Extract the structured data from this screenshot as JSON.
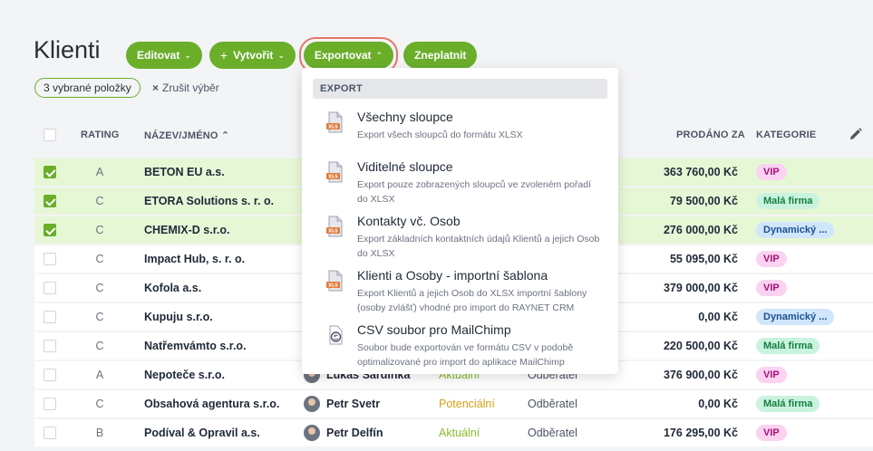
{
  "page": {
    "title": "Klienti"
  },
  "toolbar": {
    "edit_label": "Editovat",
    "create_label": "Vytvořit",
    "export_label": "Exportovat",
    "pay_label": "Zneplatnit"
  },
  "selection": {
    "count_label": "3 vybrané položky",
    "clear_label": "Zrušit výběr"
  },
  "table": {
    "headers": {
      "rating": "RATING",
      "name": "NÁZEV/JMÉNO",
      "sold": "PRODÁNO ZA",
      "category": "KATEGORIE"
    },
    "rows": [
      {
        "selected": true,
        "rating": "A",
        "name": "BETON EU a.s.",
        "person": "",
        "status": "",
        "role": "",
        "amount": "363 760,00 Kč",
        "category": "VIP",
        "cat_type": "vip"
      },
      {
        "selected": true,
        "rating": "C",
        "name": "ETORA Solutions s. r. o.",
        "person": "",
        "status": "",
        "role": "",
        "amount": "79 500,00 Kč",
        "category": "Malá firma",
        "cat_type": "mala"
      },
      {
        "selected": true,
        "rating": "C",
        "name": "CHEMIX-D s.r.o.",
        "person": "",
        "status": "",
        "role": "",
        "amount": "276 000,00 Kč",
        "category": "Dynamický ...",
        "cat_type": "dyn"
      },
      {
        "selected": false,
        "rating": "C",
        "name": "Impact Hub, s. r. o.",
        "person": "",
        "status": "",
        "role": "",
        "amount": "55 095,00 Kč",
        "category": "VIP",
        "cat_type": "vip"
      },
      {
        "selected": false,
        "rating": "C",
        "name": "Kofola a.s.",
        "person": "",
        "status": "",
        "role": "",
        "amount": "379 000,00 Kč",
        "category": "VIP",
        "cat_type": "vip"
      },
      {
        "selected": false,
        "rating": "C",
        "name": "Kupuju s.r.o.",
        "person": "",
        "status": "",
        "role": "",
        "amount": "0,00 Kč",
        "category": "Dynamický ...",
        "cat_type": "dyn"
      },
      {
        "selected": false,
        "rating": "C",
        "name": "Natřemvámto s.r.o.",
        "person": "",
        "status": "",
        "role": "",
        "amount": "220 500,00 Kč",
        "category": "Malá firma",
        "cat_type": "mala"
      },
      {
        "selected": false,
        "rating": "A",
        "name": "Nepoteče s.r.o.",
        "person": "Lukáš Sardinka",
        "status": "Aktuální",
        "role": "Odběratel",
        "amount": "376 900,00 Kč",
        "category": "VIP",
        "cat_type": "vip"
      },
      {
        "selected": false,
        "rating": "C",
        "name": "Obsahová agentura s.r.o.",
        "person": "Petr Svetr",
        "status": "Potenciální",
        "role": "Odběratel",
        "amount": "0,00 Kč",
        "category": "Malá firma",
        "cat_type": "mala"
      },
      {
        "selected": false,
        "rating": "B",
        "name": "Podíval & Opravil a.s.",
        "person": "Petr Delfín",
        "status": "Aktuální",
        "role": "Odběratel",
        "amount": "176 295,00 Kč",
        "category": "VIP",
        "cat_type": "vip"
      }
    ]
  },
  "export_menu": {
    "header": "EXPORT",
    "items": [
      {
        "title": "Všechny sloupce",
        "desc": "Export všech sloupců do formátu XLSX",
        "icon": "xls-file-icon"
      },
      {
        "title": "Viditelné sloupce",
        "desc": "Export pouze zobrazených sloupců ve zvoleném pořadí do XLSX",
        "icon": "xls-file-icon"
      },
      {
        "title": "Kontakty vč. Osob",
        "desc": "Export základních kontaktních údajů Klientů a jejich Osob do XLSX",
        "icon": "xls-file-icon"
      },
      {
        "title": "Klienti a Osoby - importní šablona",
        "desc": "Export Klientů a jejich Osob do XLSX importní šablony (osoby zvlášť) vhodné pro import do RAYNET CRM",
        "icon": "xls-file-icon"
      },
      {
        "title": "CSV soubor pro MailChimp",
        "desc": "Soubor bude exportován ve formátu CSV v podobě optimalizované pro import do aplikace MailChimp",
        "icon": "mailchimp-icon"
      }
    ]
  },
  "colors": {
    "accent": "#6aae2a",
    "highlight": "#e0796a",
    "selected_row": "#e6f7d6"
  }
}
